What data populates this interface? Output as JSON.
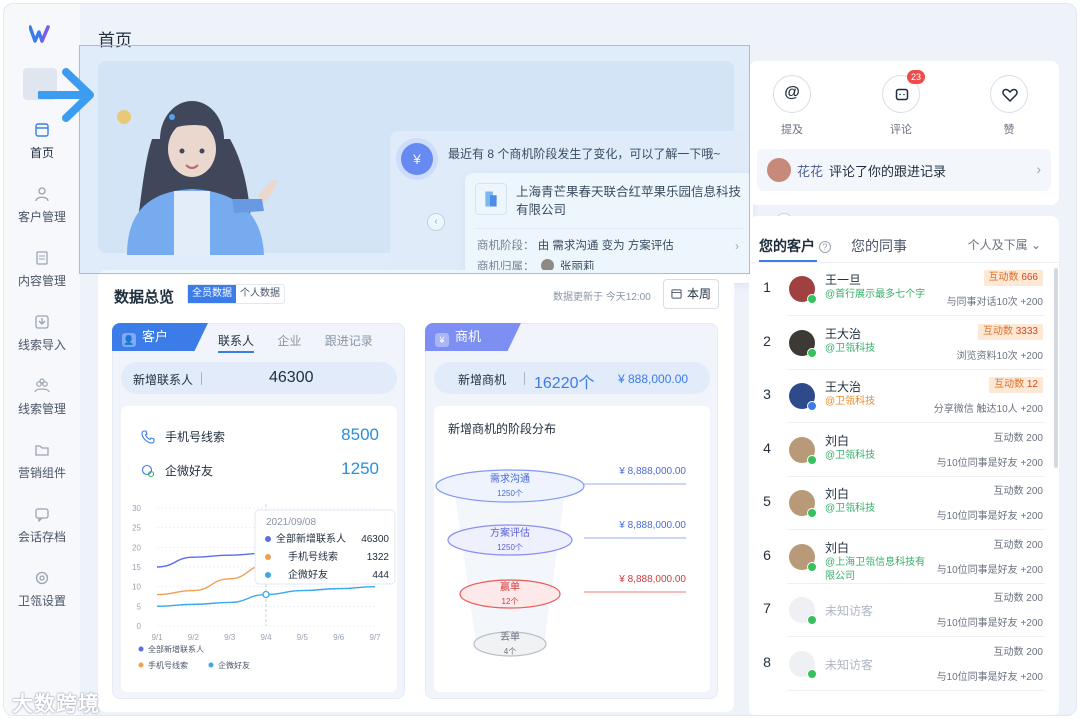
{
  "header": {
    "title": "首页"
  },
  "sidebar": {
    "items": [
      {
        "label": "首页",
        "icon": "home-icon"
      },
      {
        "label": "客户管理",
        "icon": "user-icon"
      },
      {
        "label": "内容管理",
        "icon": "document-icon"
      },
      {
        "label": "线索导入",
        "icon": "import-icon"
      },
      {
        "label": "线索管理",
        "icon": "users-icon"
      },
      {
        "label": "营销组件",
        "icon": "folder-icon"
      },
      {
        "label": "会话存档",
        "icon": "chat-icon"
      },
      {
        "label": "卫瓴设置",
        "icon": "settings-icon"
      }
    ]
  },
  "banner": {
    "message": "最近有 8 个商机阶段发生了变化，可以了解一下哦~",
    "notice_icon": "¥",
    "card": {
      "company": "上海青芒果春天联合红苹果乐园信息科技有限公司",
      "stage_label": "商机阶段：",
      "stage_from_prefix": "由",
      "stage_from": "需求沟通",
      "stage_mid": "变为",
      "stage_to": "方案评估",
      "owner_label": "商机归属：",
      "owner": "张丽莉"
    }
  },
  "overview": {
    "title": "数据总览",
    "tabs": [
      "全员数据",
      "个人数据"
    ],
    "updated": "数据更新于 今天12:00",
    "week_btn": "本周",
    "customer": {
      "tag": "客户",
      "subtabs": [
        "联系人",
        "企业",
        "跟进记录"
      ],
      "new_label": "新增联系人",
      "new_value": "46300",
      "metrics": [
        {
          "label": "手机号线索",
          "value": "8500"
        },
        {
          "label": "企微好友",
          "value": "1250"
        }
      ],
      "tooltip": {
        "date": "2021/09/08",
        "rows": [
          {
            "label": "全部新增联系人",
            "value": "46300"
          },
          {
            "label": "手机号线索",
            "value": "1322"
          },
          {
            "label": "企微好友",
            "value": "444"
          }
        ]
      },
      "legend": [
        "全部新增联系人",
        "手机号线索",
        "企微好友"
      ]
    },
    "opportunity": {
      "tag": "商机",
      "new_label": "新增商机",
      "new_count": "16220个",
      "new_amount": "¥ 888,000.00",
      "funnel_title": "新增商机的阶段分布",
      "stages": [
        {
          "name": "需求沟通",
          "count": "1250个",
          "amount": "¥ 8,888,000.00"
        },
        {
          "name": "方案评估",
          "count": "1250个",
          "amount": "¥ 8,888,000.00"
        },
        {
          "name": "赢单",
          "count": "12个",
          "amount": "¥ 8,888,000.00"
        },
        {
          "name": "丢单",
          "count": "4个",
          "amount": ""
        }
      ]
    }
  },
  "chart_data": {
    "type": "line",
    "categories": [
      "9/1",
      "9/2",
      "9/3",
      "9/4",
      "9/5",
      "9/6",
      "9/7"
    ],
    "ylim": [
      0,
      30
    ],
    "yticks": [
      "0",
      "5",
      "10",
      "15",
      "20",
      "25",
      "30"
    ],
    "series": [
      {
        "name": "全部新增联系人",
        "color": "#5b6ee8",
        "values": [
          15,
          17.5,
          18,
          18.5,
          19,
          19.5,
          20
        ]
      },
      {
        "name": "手机号线索",
        "color": "#f0a050",
        "values": [
          8,
          9,
          12,
          15.5,
          16,
          16.5,
          17
        ]
      },
      {
        "name": "企微好友",
        "color": "#3aa8e8",
        "values": [
          5,
          5.5,
          6,
          8,
          9,
          9.5,
          10
        ]
      }
    ]
  },
  "right": {
    "actions": [
      {
        "label": "提及",
        "icon": "at-icon",
        "badge": ""
      },
      {
        "label": "评论",
        "icon": "comment-icon",
        "badge": "23"
      },
      {
        "label": "赞",
        "icon": "heart-icon",
        "badge": ""
      }
    ],
    "comment": {
      "name": "花花",
      "text": "评论了你的跟进记录"
    },
    "tabs": [
      "您的客户",
      "您的同事"
    ],
    "filter": "个人及下属",
    "customers": [
      {
        "rank": "1",
        "name": "王一旦",
        "source": "@首行展示最多七个字",
        "tag_label": "互动数",
        "tag_value": "666",
        "desc": "与同事对话10次 +200",
        "av": "#a04040",
        "color": "green"
      },
      {
        "rank": "2",
        "name": "王大治",
        "source": "@卫瓴科技",
        "tag_label": "互动数",
        "tag_value": "3333",
        "desc": "浏览资料10次 +200",
        "av": "#3d3a35",
        "color": "green"
      },
      {
        "rank": "3",
        "name": "王大治",
        "source": "@卫瓴科技",
        "tag_label": "互动数",
        "tag_value": "12",
        "desc": "分享微信 触达10人 +200",
        "av": "#2f4a8a",
        "color": "org"
      },
      {
        "rank": "4",
        "name": "刘白",
        "source": "@卫瓴科技",
        "tag_label": "互动数 200",
        "tag_value": "",
        "desc": "与10位同事是好友 +200",
        "av": "#b89a78",
        "color": "green"
      },
      {
        "rank": "5",
        "name": "刘白",
        "source": "@卫瓴科技",
        "tag_label": "互动数 200",
        "tag_value": "",
        "desc": "与10位同事是好友 +200",
        "av": "#b89a78",
        "color": "green"
      },
      {
        "rank": "6",
        "name": "刘白",
        "source": "@上海卫瓴信息科技有限公司",
        "tag_label": "互动数 200",
        "tag_value": "",
        "desc": "与10位同事是好友 +200",
        "av": "#b89a78",
        "color": "green"
      },
      {
        "rank": "7",
        "name": "未知访客",
        "source": "",
        "tag_label": "互动数 200",
        "tag_value": "",
        "desc": "与10位同事是好友 +200",
        "av": "#eef0f3",
        "color": "grey"
      },
      {
        "rank": "8",
        "name": "未知访客",
        "source": "",
        "tag_label": "互动数 200",
        "tag_value": "",
        "desc": "与10位同事是好友 +200",
        "av": "#eef0f3",
        "color": "grey"
      }
    ]
  },
  "watermark": "大数跨境",
  "colors": {
    "primary": "#3b7ce8",
    "accent_purple": "#6c7ff2",
    "green": "#35b06a",
    "orange": "#f08a24",
    "red": "#e84a4a"
  }
}
